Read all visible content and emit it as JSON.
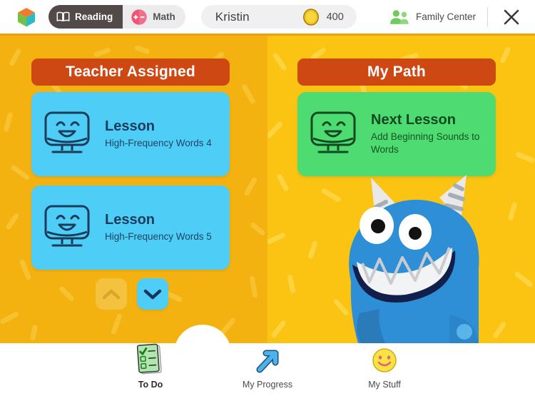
{
  "topbar": {
    "logo_icon": "cube-logo-icon",
    "subjects": [
      {
        "label": "Reading",
        "icon": "open-book-icon",
        "active": true
      },
      {
        "label": "Math",
        "icon": "plus-minus-icon",
        "active": false
      }
    ],
    "user_name": "Kristin",
    "coin_icon": "gold-coin-icon",
    "coin_value": "400",
    "family_center_label": "Family Center",
    "family_center_icon": "two-people-icon",
    "close_icon": "close-x-icon"
  },
  "stage": {
    "left": {
      "header": "Teacher Assigned",
      "cards": [
        {
          "icon": "smiling-monitor-icon",
          "title": "Lesson",
          "subtitle": "High-Frequency Words 4"
        },
        {
          "icon": "smiling-monitor-icon",
          "title": "Lesson",
          "subtitle": "High-Frequency Words 5"
        }
      ],
      "pager": {
        "up": {
          "icon": "chevron-up-icon",
          "enabled": false
        },
        "down": {
          "icon": "chevron-down-icon",
          "enabled": true
        }
      }
    },
    "right": {
      "header": "My Path",
      "cards": [
        {
          "icon": "smiling-monitor-icon",
          "title": "Next Lesson",
          "subtitle": "Add Beginning Sounds to Words"
        }
      ],
      "character": "blue-monster-mascot"
    }
  },
  "bottomnav": {
    "items": [
      {
        "label": "To Do",
        "icon": "checklist-icon",
        "active": true
      },
      {
        "label": "My Progress",
        "icon": "arrow-up-right-icon",
        "active": false
      },
      {
        "label": "My Stuff",
        "icon": "smiley-face-icon",
        "active": false
      }
    ]
  },
  "colors": {
    "stage_left": "#f4b211",
    "stage_right": "#fbc412",
    "header_banner": "#ce4814",
    "card_blue": "#4ecdf7",
    "card_green": "#4edb72",
    "toggle_active": "#514a49",
    "math_pink": "#ef5575",
    "coin_gold": "#f5c518",
    "monster_blue": "#2f8fd6"
  }
}
